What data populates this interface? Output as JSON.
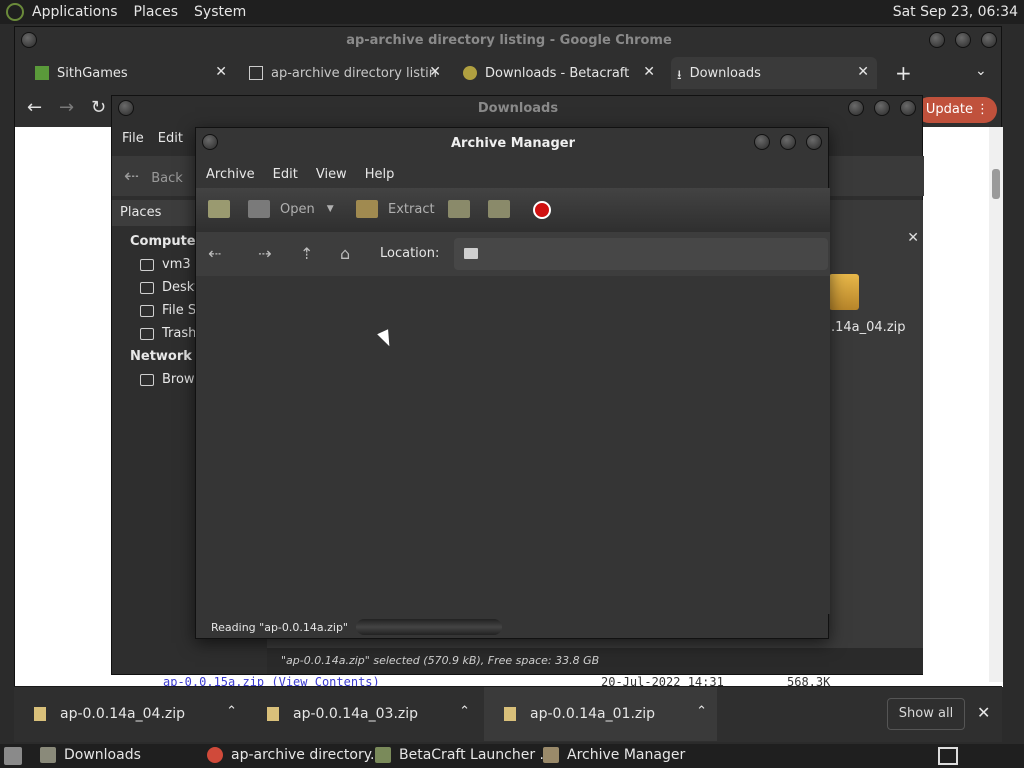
{
  "top_panel": {
    "menus": [
      "Applications",
      "Places",
      "System"
    ],
    "clock": "Sat Sep 23, 06:34"
  },
  "chrome": {
    "title": "ap-archive directory listing - Google Chrome",
    "tabs": [
      {
        "label": "SithGames",
        "icon": "minecraft-block-icon"
      },
      {
        "label": "ap-archive directory listin",
        "icon": "archive-building-icon"
      },
      {
        "label": "Downloads - Betacraft",
        "icon": "betacraft-icon"
      },
      {
        "label": "Downloads",
        "icon": "download-icon"
      }
    ],
    "new_tab": "+",
    "update_label": "Update",
    "page": {
      "link_text": "ap-0.0.15a.zip (View Contents)",
      "date": "20-Jul-2022 14:31",
      "size": "568.3K"
    }
  },
  "file_manager": {
    "title": "Downloads",
    "menus": [
      "File",
      "Edit"
    ],
    "back_label": "Back",
    "sidebar_header": "Places",
    "sections": [
      {
        "heading": "Computer",
        "items": [
          "vm3",
          "Deskt",
          "File S",
          "Trash"
        ]
      },
      {
        "heading": "Network",
        "items": [
          "Brows"
        ]
      }
    ],
    "visible_file": ".14a_04.zip",
    "status": "\"ap-0.0.14a.zip\" selected (570.9 kB), Free space: 33.8 GB"
  },
  "archive_manager": {
    "title": "Archive Manager",
    "menus": [
      "Archive",
      "Edit",
      "View",
      "Help"
    ],
    "toolbar": {
      "open_label": "Open",
      "extract_label": "Extract"
    },
    "location_label": "Location:",
    "status_text": "Reading \"ap-0.0.14a.zip\""
  },
  "downloads_bar": {
    "items": [
      "ap-0.0.14a_04.zip",
      "ap-0.0.14a_03.zip",
      "ap-0.0.14a_01.zip"
    ],
    "show_all": "Show all"
  },
  "taskbar": {
    "items": [
      "Downloads",
      "ap-archive directory...",
      "BetaCraft Launcher ...",
      "Archive Manager"
    ]
  }
}
